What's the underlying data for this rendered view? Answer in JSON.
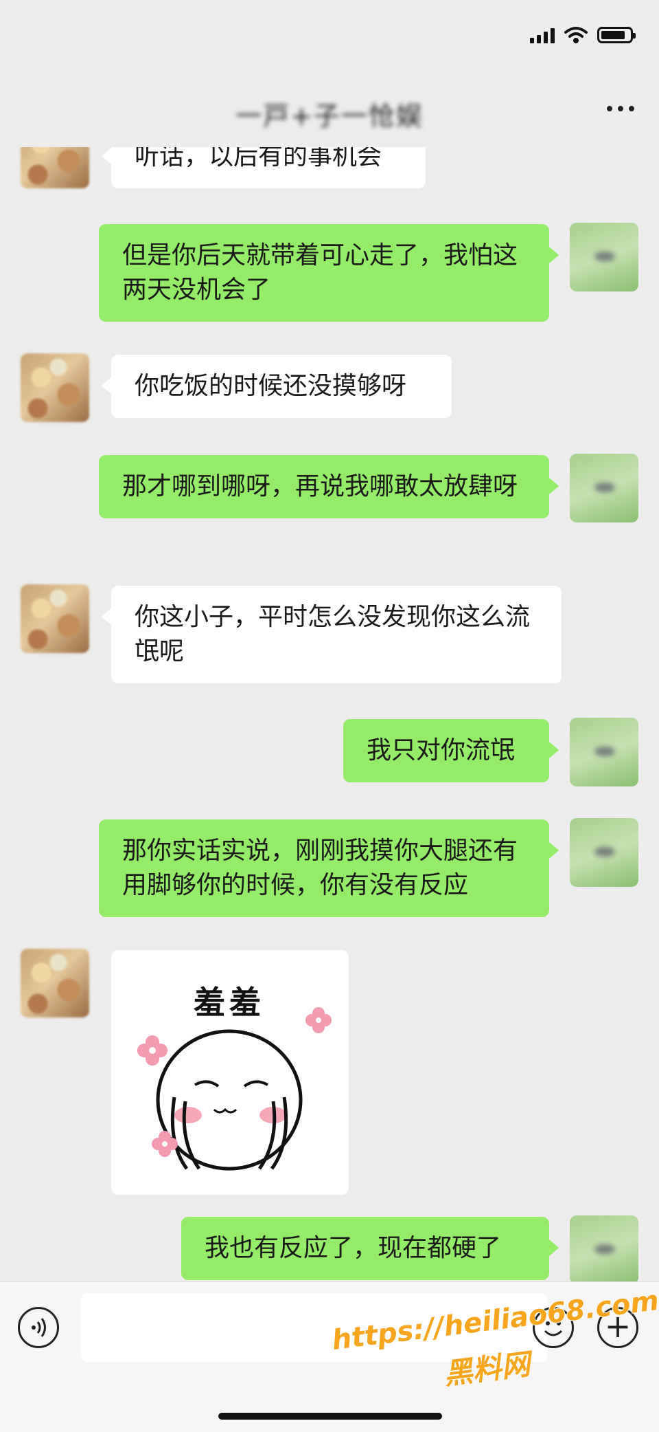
{
  "status_bar": {
    "signal_icon": "cellular-signal-icon",
    "wifi_icon": "wifi-icon",
    "battery_icon": "battery-icon"
  },
  "header": {
    "title": "一戸+子一怆娱",
    "more_icon": "more-dots-icon"
  },
  "messages": [
    {
      "side": "in",
      "text": "听话，以后有的事机会"
    },
    {
      "side": "out",
      "text": "但是你后天就带着可心走了，我怕这两天没机会了"
    },
    {
      "side": "in",
      "text": "你吃饭的时候还没摸够呀"
    },
    {
      "side": "out",
      "text": "那才哪到哪呀，再说我哪敢太放肆呀"
    },
    {
      "side": "in",
      "text": "你这小子，平时怎么没发现你这么流氓呢"
    },
    {
      "side": "out",
      "text": "我只对你流氓"
    },
    {
      "side": "out",
      "text": "那你实话实说，刚刚我摸你大腿还有用脚够你的时候，你有没有反应"
    },
    {
      "side": "in",
      "type": "sticker",
      "caption": "羞羞"
    },
    {
      "side": "out",
      "text": "我也有反应了，现在都硬了"
    }
  ],
  "input_bar": {
    "voice_icon": "voice-icon",
    "emoji_icon": "emoji-icon",
    "plus_icon": "plus-icon",
    "plus_glyph": "+"
  },
  "watermark": {
    "url": "https://heiliao68.com",
    "label": "黑料网"
  },
  "colors": {
    "outgoing_bubble": "#95ec69",
    "incoming_bubble": "#ffffff",
    "background": "#ededed"
  }
}
